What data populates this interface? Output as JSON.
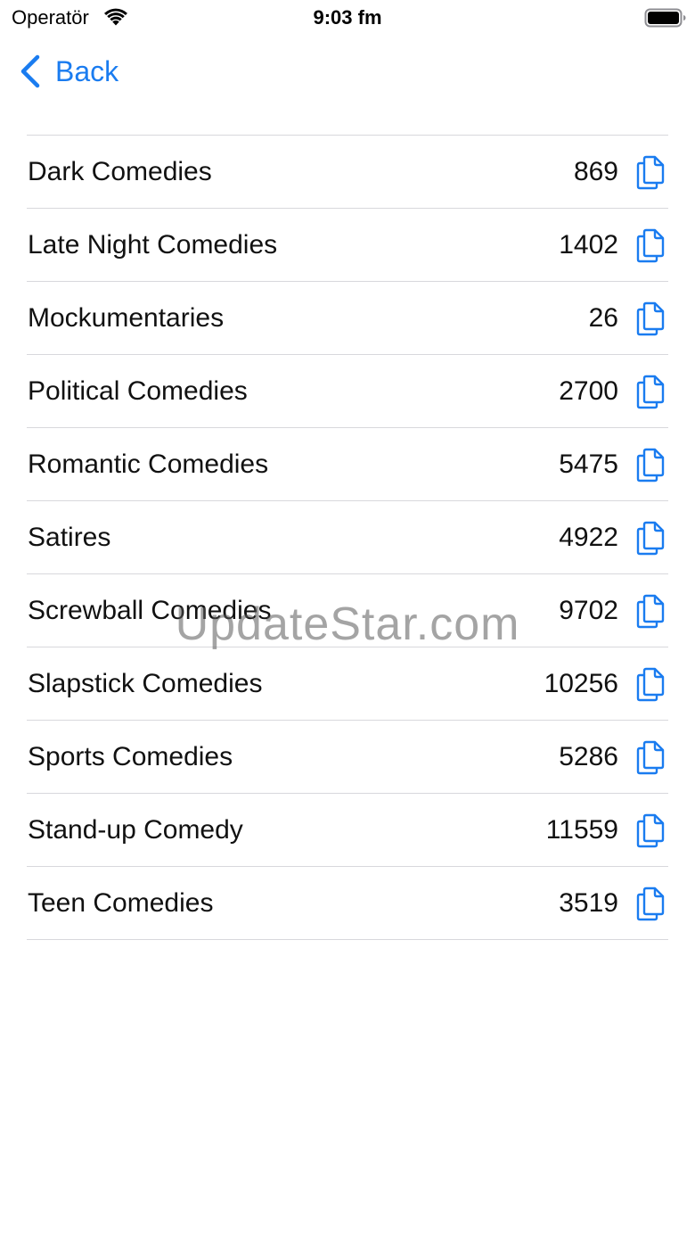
{
  "status_bar": {
    "carrier": "Operatör",
    "time": "9:03 fm",
    "wifi_icon": "wifi-icon",
    "battery_icon": "battery-icon"
  },
  "nav": {
    "back_label": "Back",
    "back_icon": "chevron-left-icon"
  },
  "colors": {
    "accent": "#1a7cf0",
    "separator": "#d8d8dc",
    "text": "#111111"
  },
  "rows": [
    {
      "label": "Dark Comedies",
      "count": "869"
    },
    {
      "label": "Late Night Comedies",
      "count": "1402"
    },
    {
      "label": "Mockumentaries",
      "count": "26"
    },
    {
      "label": "Political Comedies",
      "count": "2700"
    },
    {
      "label": "Romantic Comedies",
      "count": "5475"
    },
    {
      "label": "Satires",
      "count": "4922"
    },
    {
      "label": "Screwball Comedies",
      "count": "9702"
    },
    {
      "label": "Slapstick Comedies",
      "count": "10256"
    },
    {
      "label": "Sports Comedies",
      "count": "5286"
    },
    {
      "label": "Stand-up Comedy",
      "count": "11559"
    },
    {
      "label": "Teen Comedies",
      "count": "3519"
    }
  ],
  "row_action_icon": "copy-documents-icon",
  "watermark": "UpdateStar.com"
}
